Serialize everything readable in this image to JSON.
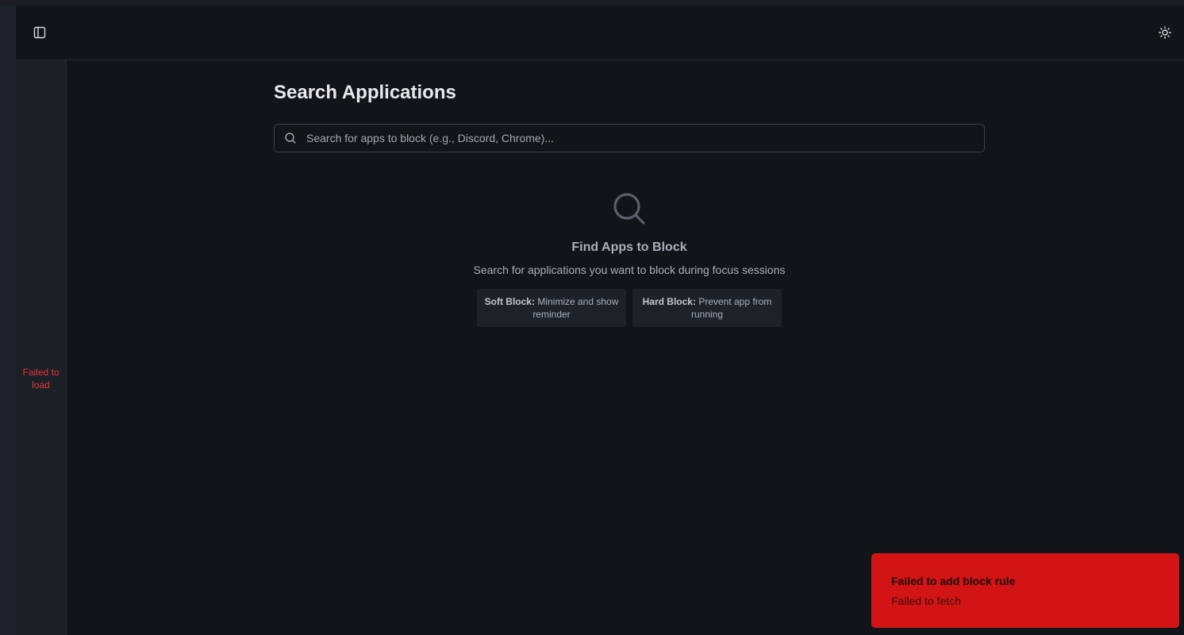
{
  "sidebar": {
    "status_text": "Failed to load"
  },
  "header": {
    "toggle_icon": "sidebar-toggle-icon",
    "theme_icon": "sun-icon"
  },
  "main": {
    "title": "Search Applications",
    "search": {
      "placeholder": "Search for apps to block (e.g., Discord, Chrome)...",
      "value": ""
    },
    "empty_state": {
      "icon": "search-icon",
      "title": "Find Apps to Block",
      "description": "Search for applications you want to block during focus sessions",
      "chips": [
        {
          "label": "Soft Block:",
          "text": " Minimize and show reminder"
        },
        {
          "label": "Hard Block:",
          "text": " Prevent app from running"
        }
      ]
    }
  },
  "toast": {
    "title": "Failed to add block rule",
    "message": "Failed to fetch",
    "color": "#d21414"
  },
  "colors": {
    "background": "#111418",
    "sidebar": "#1b1f26",
    "error_text": "#e5353a"
  }
}
